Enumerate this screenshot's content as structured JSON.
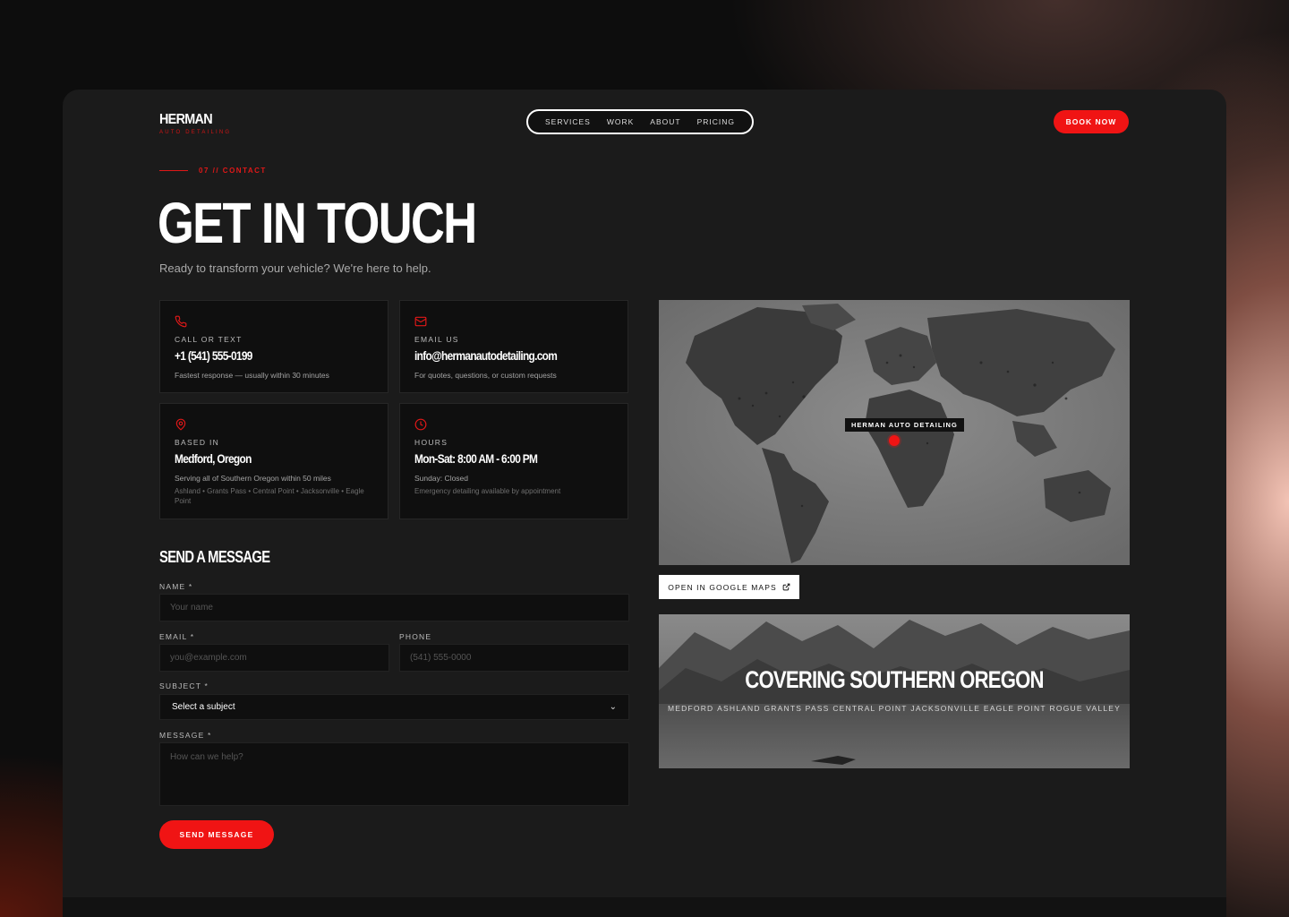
{
  "brand": {
    "name": "HERMAN",
    "tagline": "AUTO DETAILING"
  },
  "nav": {
    "items": [
      "SERVICES",
      "WORK",
      "ABOUT",
      "PRICING"
    ],
    "cta": "BOOK NOW"
  },
  "hero": {
    "eyebrow": "07 // CONTACT",
    "title": "GET IN TOUCH",
    "subtitle": "Ready to transform your vehicle? We're here to help."
  },
  "cards": {
    "phone": {
      "icon": "phone-icon",
      "label": "CALL OR TEXT",
      "value": "+1 (541) 555-0199",
      "note": "Fastest response — usually within 30 minutes"
    },
    "email": {
      "icon": "mail-icon",
      "label": "EMAIL US",
      "value": "info@hermanautodetailing.com",
      "note": "For quotes, questions, or custom requests"
    },
    "location": {
      "icon": "map-pin-icon",
      "label": "BASED IN",
      "value": "Medford, Oregon",
      "note": "Serving all of Southern Oregon within 50 miles",
      "note2": "Ashland • Grants Pass • Central Point • Jacksonville • Eagle Point"
    },
    "hours": {
      "icon": "clock-icon",
      "label": "HOURS",
      "value": "Mon-Sat: 8:00 AM - 6:00 PM",
      "note": "Sunday: Closed",
      "note2": "Emergency detailing available by appointment"
    }
  },
  "form": {
    "title": "SEND A MESSAGE",
    "name_label": "NAME *",
    "name_placeholder": "Your name",
    "email_label": "EMAIL *",
    "email_placeholder": "you@example.com",
    "phone_label": "PHONE",
    "phone_placeholder": "(541) 555-0000",
    "subject_label": "SUBJECT *",
    "subject_value": "Select a subject",
    "message_label": "MESSAGE *",
    "message_placeholder": "How can we help?",
    "submit": "SEND MESSAGE"
  },
  "map": {
    "pin_label": "HERMAN AUTO DETAILING",
    "open_button": "OPEN IN GOOGLE MAPS",
    "open_icon": "external-link-icon"
  },
  "region": {
    "title": "COVERING SOUTHERN OREGON",
    "towns": [
      "MEDFORD",
      "ASHLAND",
      "GRANTS PASS",
      "CENTRAL POINT",
      "JACKSONVILLE",
      "EAGLE POINT",
      "ROGUE VALLEY"
    ]
  },
  "colors": {
    "accent": "#f01414",
    "panel": "#1b1b1b",
    "card": "#0f0f0f"
  }
}
